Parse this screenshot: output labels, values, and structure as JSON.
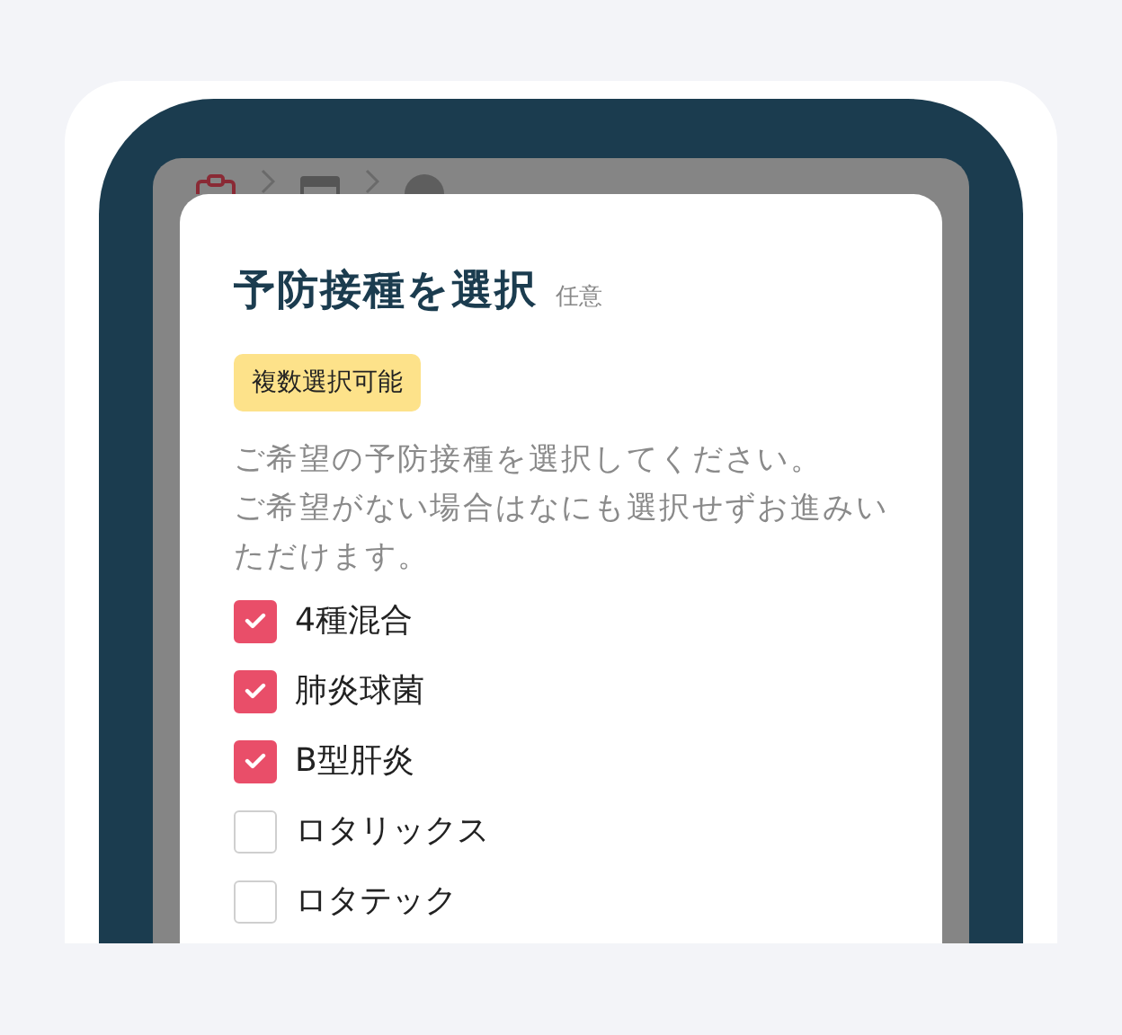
{
  "modal": {
    "title": "予防接種を選択",
    "optional_label": "任意",
    "badge": "複数選択可能",
    "description": [
      "ご希望の予防接種を選択してください。",
      "ご希望がない場合はなにも選択せずお進みいただけます。"
    ],
    "options": [
      {
        "label": "4種混合",
        "checked": true
      },
      {
        "label": "肺炎球菌",
        "checked": true
      },
      {
        "label": "B型肝炎",
        "checked": true
      },
      {
        "label": "ロタリックス",
        "checked": false
      },
      {
        "label": "ロタテック",
        "checked": false
      }
    ]
  }
}
